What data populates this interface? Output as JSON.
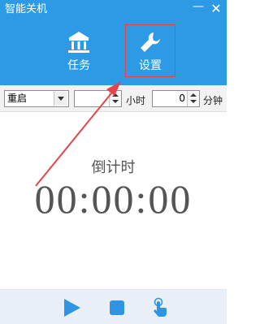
{
  "window": {
    "title": "智能关机"
  },
  "titlebar": {
    "minimize_symbol": "—",
    "close_symbol": "✕"
  },
  "tabs": [
    {
      "label": "任务",
      "icon": "bank-icon",
      "selected": false
    },
    {
      "label": "设置",
      "icon": "wrench-icon",
      "selected": true
    }
  ],
  "controls": {
    "action_select": {
      "value": "重启"
    },
    "hours": {
      "value": "",
      "unit": "小时"
    },
    "minutes": {
      "value": "0",
      "unit": "分钟"
    }
  },
  "countdown": {
    "label": "倒计时",
    "time": "00:00:00"
  },
  "footer": {
    "buttons": [
      {
        "name": "play",
        "icon": "play-icon"
      },
      {
        "name": "stop",
        "icon": "stop-icon"
      },
      {
        "name": "pointer",
        "icon": "hand-pointer-icon"
      }
    ]
  },
  "colors": {
    "header_bg": "#2d9ae6",
    "footer_bg": "#e8eff7",
    "accent_red": "#e2454a",
    "button_blue": "#2f95e3"
  }
}
